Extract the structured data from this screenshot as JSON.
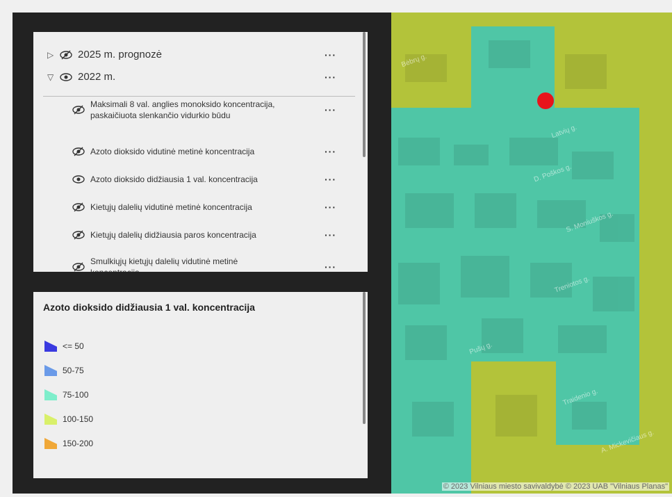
{
  "layers": {
    "top": [
      {
        "label": "2025 m. prognozė",
        "caret": "▷",
        "expanded": false
      },
      {
        "label": "2022 m.",
        "caret": "▽",
        "expanded": true
      }
    ],
    "sub": [
      {
        "label": "Maksimali 8 val. anglies monoksido koncentracija, paskaičiuota slenkančio vidurkio būdu",
        "visible": false
      },
      {
        "label": "Azoto dioksido vidutinė metinė koncentracija",
        "visible": false
      },
      {
        "label": "Azoto dioksido didžiausia 1 val. koncentracija",
        "visible": true
      },
      {
        "label": "Kietųjų dalelių vidutinė metinė koncentracija",
        "visible": false
      },
      {
        "label": "Kietųjų dalelių didžiausia paros koncentracija",
        "visible": false
      },
      {
        "label": "Smulkiųjų kietųjų dalelių vidutinė metinė koncentracija",
        "visible": false
      }
    ],
    "more_label": "···"
  },
  "legend": {
    "title": "Azoto dioksido didžiausia 1 val. koncentracija",
    "items": [
      {
        "label": "<= 50",
        "color": "#3a3ae0"
      },
      {
        "label": "50-75",
        "color": "#6a9ae8"
      },
      {
        "label": "75-100",
        "color": "#7eeecb"
      },
      {
        "label": "100-150",
        "color": "#d9f06a"
      },
      {
        "label": "150-200",
        "color": "#f0a838"
      }
    ]
  },
  "map": {
    "colors": {
      "low": "#4fc6a6",
      "high": "#b3c33a",
      "marker": "#e8141b"
    },
    "streets": [
      "Bėbrų g.",
      "Latvių g.",
      "D. Poškos g.",
      "S. Moniuškos g.",
      "Treniotos g.",
      "Pušų g.",
      "Traidenio g.",
      "A. Mickevičiaus g."
    ],
    "attribution": "© 2023 Vilniaus miesto savivaldybė © 2023 UAB \"Vilniaus Planas\""
  }
}
